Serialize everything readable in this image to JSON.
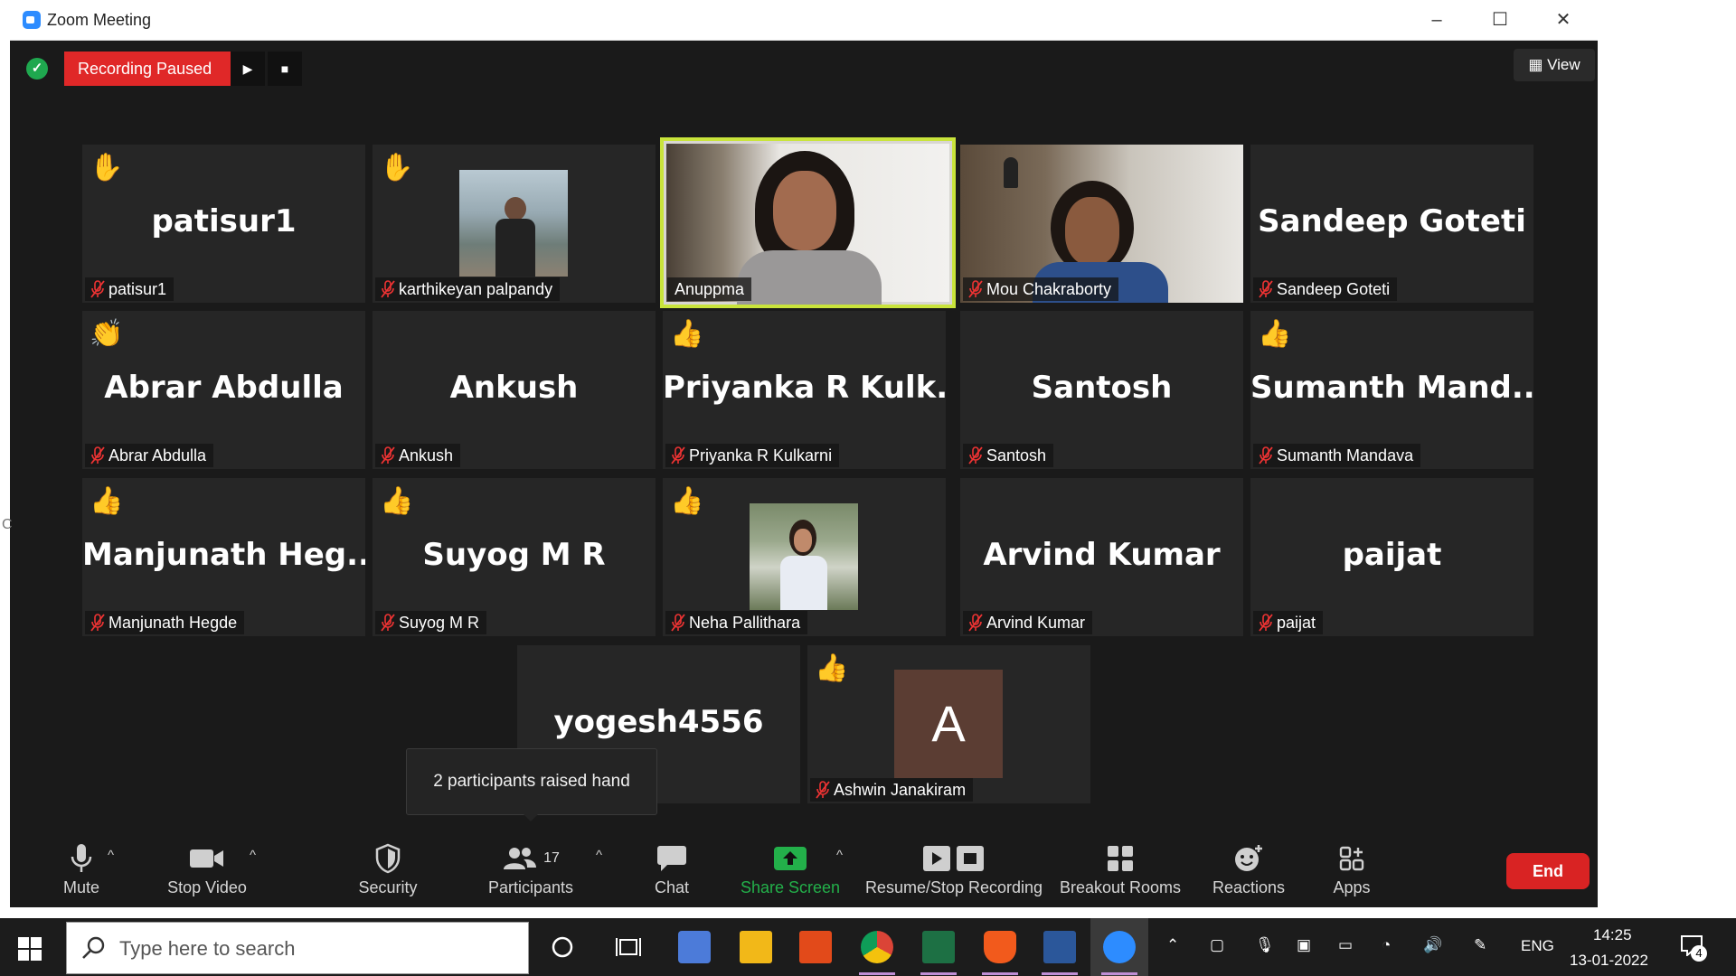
{
  "window": {
    "title": "Zoom Meeting",
    "controls": [
      "–",
      "☐",
      "✕"
    ]
  },
  "top_bar": {
    "recording_status": "Recording Paused",
    "view_label": "View"
  },
  "tiles": [
    {
      "display_name": "patisur1",
      "name": "patisur1",
      "reaction": "✋",
      "muted": true
    },
    {
      "display_name": "",
      "name": "karthikeyan palpandy",
      "reaction": "✋",
      "muted": true,
      "has_photo": true
    },
    {
      "display_name": "",
      "name": "Anuppma",
      "reaction": "",
      "muted": false,
      "video": true,
      "active": true
    },
    {
      "display_name": "",
      "name": "Mou Chakraborty",
      "reaction": "",
      "muted": true,
      "video": true
    },
    {
      "display_name": "Sandeep Goteti",
      "name": "Sandeep Goteti",
      "reaction": "",
      "muted": true
    },
    {
      "display_name": "Abrar Abdulla",
      "name": "Abrar Abdulla",
      "reaction": "👏",
      "muted": true
    },
    {
      "display_name": "Ankush",
      "name": "Ankush",
      "reaction": "",
      "muted": true
    },
    {
      "display_name": "Priyanka  R  Kulk...",
      "name": "Priyanka R Kulkarni",
      "reaction": "👍",
      "muted": true
    },
    {
      "display_name": "Santosh",
      "name": "Santosh",
      "reaction": "",
      "muted": true
    },
    {
      "display_name": "Sumanth  Mand...",
      "name": "Sumanth Mandava",
      "reaction": "👍",
      "muted": true
    },
    {
      "display_name": "Manjunath  Heg...",
      "name": "Manjunath Hegde",
      "reaction": "👍",
      "muted": true
    },
    {
      "display_name": "Suyog M R",
      "name": "Suyog M R",
      "reaction": "👍",
      "muted": true
    },
    {
      "display_name": "",
      "name": "Neha Pallithara",
      "reaction": "👍",
      "muted": true,
      "has_photo": true
    },
    {
      "display_name": "Arvind Kumar",
      "name": "Arvind Kumar",
      "reaction": "",
      "muted": true
    },
    {
      "display_name": "paijat",
      "name": "paijat",
      "reaction": "",
      "muted": true
    },
    {
      "display_name": "yogesh4556",
      "name": "",
      "reaction": "",
      "muted": false
    },
    {
      "display_name": "",
      "name": "Ashwin Janakiram",
      "reaction": "👍",
      "muted": true,
      "avatar_letter": "A"
    }
  ],
  "tooltip": "2 participants raised hand",
  "toolbar": {
    "mute": "Mute",
    "stop_video": "Stop Video",
    "security": "Security",
    "participants": "Participants",
    "participants_count": "17",
    "chat": "Chat",
    "share_screen": "Share Screen",
    "recording": "Resume/Stop Recording",
    "breakout": "Breakout Rooms",
    "reactions": "Reactions",
    "apps": "Apps",
    "end": "End"
  },
  "taskbar": {
    "search_placeholder": "Type here to search",
    "language": "ENG",
    "time": "14:25",
    "date": "13-01-2022",
    "notification_count": "4"
  },
  "colors": {
    "recording_red": "#e02828",
    "end_red": "#d92323",
    "share_green": "#23b04a",
    "active_speaker": "#c9e43b"
  }
}
